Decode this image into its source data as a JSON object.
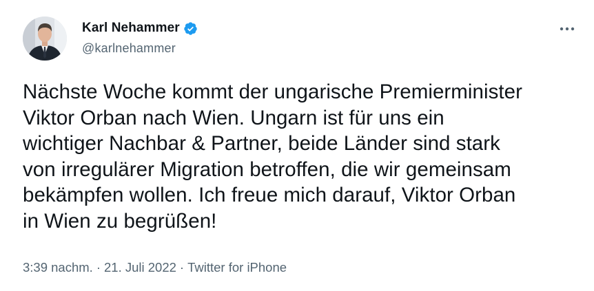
{
  "author": {
    "display_name": "Karl Nehammer",
    "handle": "@karlnehammer",
    "verified": true
  },
  "tweet": {
    "text": "Nächste Woche kommt der ungarische Premierminister\nViktor Orban nach Wien. Ungarn ist für uns ein\nwichtiger Nachbar & Partner, beide Länder sind stark\nvon irregulärer Migration betroffen, die wir gemeinsam\nbekämpfen wollen. Ich freue mich darauf, Viktor Orban\nin Wien zu begrüßen!"
  },
  "meta": {
    "time": "3:39 nachm.",
    "separator": "·",
    "date": "21. Juli 2022",
    "source": "Twitter for iPhone"
  },
  "icons": {
    "verified": "verified-badge-icon",
    "more": "more-options-icon"
  },
  "colors": {
    "text": "#0f1419",
    "secondary": "#536471",
    "verified": "#1d9bf0",
    "background": "#ffffff"
  }
}
